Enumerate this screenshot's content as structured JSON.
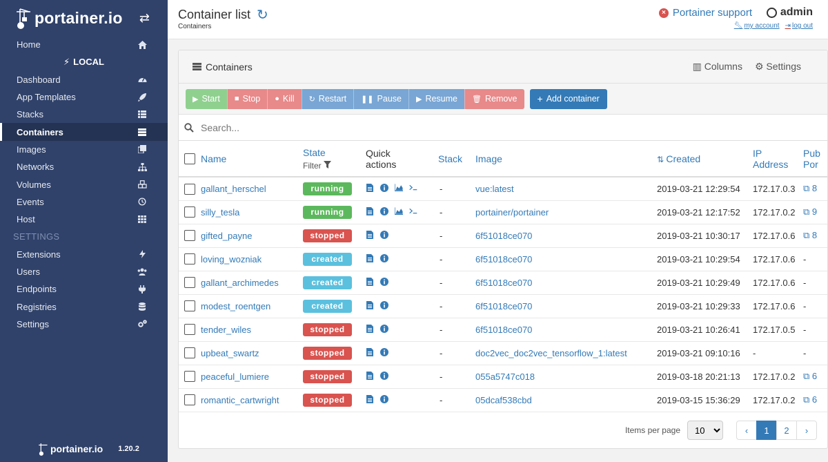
{
  "sidebar": {
    "brand": "portainer.io",
    "local_label": "LOCAL",
    "settings_section": "SETTINGS",
    "items": [
      {
        "label": "Home",
        "icon": "home-icon"
      },
      {
        "label": "Dashboard",
        "icon": "tachometer-icon"
      },
      {
        "label": "App Templates",
        "icon": "rocket-icon"
      },
      {
        "label": "Stacks",
        "icon": "th-list-icon"
      },
      {
        "label": "Containers",
        "icon": "server-icon"
      },
      {
        "label": "Images",
        "icon": "clone-icon"
      },
      {
        "label": "Networks",
        "icon": "sitemap-icon"
      },
      {
        "label": "Volumes",
        "icon": "cubes-icon"
      },
      {
        "label": "Events",
        "icon": "history-icon"
      },
      {
        "label": "Host",
        "icon": "th-icon"
      }
    ],
    "settings_items": [
      {
        "label": "Extensions",
        "icon": "bolt-icon"
      },
      {
        "label": "Users",
        "icon": "users-icon"
      },
      {
        "label": "Endpoints",
        "icon": "plug-icon"
      },
      {
        "label": "Registries",
        "icon": "database-icon"
      },
      {
        "label": "Settings",
        "icon": "cogs-icon"
      }
    ],
    "footer_brand": "portainer.io",
    "version": "1.20.2"
  },
  "header": {
    "title": "Container list",
    "breadcrumb": "Containers",
    "support": "Portainer support",
    "user": "admin",
    "my_account": "my account",
    "log_out": "log out"
  },
  "panel": {
    "title": "Containers",
    "columns_label": "Columns",
    "settings_label": "Settings"
  },
  "toolbar": {
    "start": "Start",
    "stop": "Stop",
    "kill": "Kill",
    "restart": "Restart",
    "pause": "Pause",
    "resume": "Resume",
    "remove": "Remove",
    "add": "Add container"
  },
  "search": {
    "placeholder": "Search..."
  },
  "table": {
    "headers": {
      "name": "Name",
      "state": "State",
      "state_filter": "Filter",
      "quick_actions_1": "Quick",
      "quick_actions_2": "actions",
      "stack": "Stack",
      "image": "Image",
      "created": "Created",
      "ip_1": "IP",
      "ip_2": "Address",
      "ports_1": "Pub",
      "ports_2": "Por"
    },
    "rows": [
      {
        "name": "gallant_herschel",
        "state": "running",
        "actions": 4,
        "stack": "-",
        "image": "vue:latest",
        "created": "2019-03-21 12:29:54",
        "ip": "172.17.0.3",
        "port": "8"
      },
      {
        "name": "silly_tesla",
        "state": "running",
        "actions": 4,
        "stack": "-",
        "image": "portainer/portainer",
        "created": "2019-03-21 12:17:52",
        "ip": "172.17.0.2",
        "port": "9"
      },
      {
        "name": "gifted_payne",
        "state": "stopped",
        "actions": 2,
        "stack": "-",
        "image": "6f51018ce070",
        "created": "2019-03-21 10:30:17",
        "ip": "172.17.0.6",
        "port": "8"
      },
      {
        "name": "loving_wozniak",
        "state": "created",
        "actions": 2,
        "stack": "-",
        "image": "6f51018ce070",
        "created": "2019-03-21 10:29:54",
        "ip": "172.17.0.6",
        "port": "-"
      },
      {
        "name": "gallant_archimedes",
        "state": "created",
        "actions": 2,
        "stack": "-",
        "image": "6f51018ce070",
        "created": "2019-03-21 10:29:49",
        "ip": "172.17.0.6",
        "port": "-"
      },
      {
        "name": "modest_roentgen",
        "state": "created",
        "actions": 2,
        "stack": "-",
        "image": "6f51018ce070",
        "created": "2019-03-21 10:29:33",
        "ip": "172.17.0.6",
        "port": "-"
      },
      {
        "name": "tender_wiles",
        "state": "stopped",
        "actions": 2,
        "stack": "-",
        "image": "6f51018ce070",
        "created": "2019-03-21 10:26:41",
        "ip": "172.17.0.5",
        "port": "-"
      },
      {
        "name": "upbeat_swartz",
        "state": "stopped",
        "actions": 2,
        "stack": "-",
        "image": "doc2vec_doc2vec_tensorflow_1:latest",
        "created": "2019-03-21 09:10:16",
        "ip": "-",
        "port": "-"
      },
      {
        "name": "peaceful_lumiere",
        "state": "stopped",
        "actions": 2,
        "stack": "-",
        "image": "055a5747c018",
        "created": "2019-03-18 20:21:13",
        "ip": "172.17.0.2",
        "port": "6"
      },
      {
        "name": "romantic_cartwright",
        "state": "stopped",
        "actions": 2,
        "stack": "-",
        "image": "05dcaf538cbd",
        "created": "2019-03-15 15:36:29",
        "ip": "172.17.0.2",
        "port": "6"
      }
    ]
  },
  "pagination": {
    "items_per_page_label": "Items per page",
    "items_per_page": "10",
    "prev": "‹",
    "pages": [
      "1",
      "2"
    ],
    "next": "›"
  },
  "colors": {
    "sidebar": "#30426a",
    "accent": "#337ab7",
    "running": "#5cb85c",
    "stopped": "#d9534f",
    "created": "#5bc0de"
  }
}
